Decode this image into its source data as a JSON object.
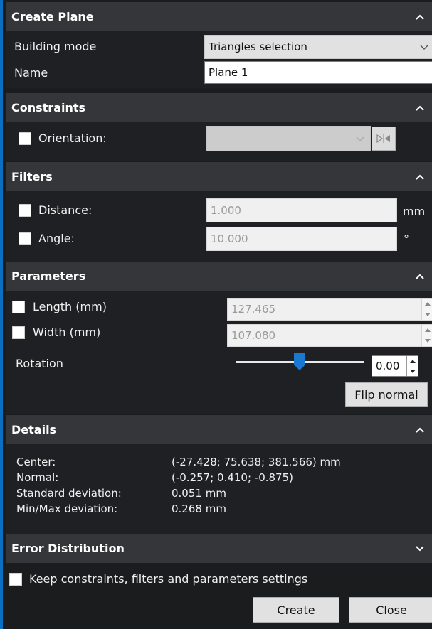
{
  "create_plane": {
    "header": "Create Plane",
    "building_mode_label": "Building mode",
    "building_mode_value": "Triangles selection",
    "name_label": "Name",
    "name_value": "Plane 1"
  },
  "constraints": {
    "header": "Constraints",
    "orientation_label": "Orientation:",
    "orientation_checked": false
  },
  "filters": {
    "header": "Filters",
    "distance_label": "Distance:",
    "distance_value": "1.000",
    "distance_unit": "mm",
    "angle_label": "Angle:",
    "angle_value": "10.000",
    "angle_unit": "°"
  },
  "parameters": {
    "header": "Parameters",
    "length_label": "Length (mm)",
    "length_value": "127.465",
    "width_label": "Width (mm)",
    "width_value": "107.080",
    "rotation_label": "Rotation",
    "rotation_value": "0.00",
    "rotation_slider_fraction": 0.5,
    "flip_normal_label": "Flip normal"
  },
  "details": {
    "header": "Details",
    "rows": [
      {
        "key": "Center:",
        "value": "(-27.428; 75.638; 381.566) mm"
      },
      {
        "key": "Normal:",
        "value": "(-0.257; 0.410; -0.875)"
      },
      {
        "key": "Standard deviation:",
        "value": "0.051 mm"
      },
      {
        "key": "Min/Max deviation:",
        "value": "0.268 mm"
      }
    ]
  },
  "error_distribution": {
    "header": "Error Distribution"
  },
  "footer": {
    "keep_settings_label": "Keep constraints, filters and parameters settings",
    "create_label": "Create",
    "close_label": "Close"
  },
  "icons": {
    "collapse": "chevron-up-icon",
    "expand": "chevron-down-icon",
    "flip_orientation": "flip-orientation-icon"
  },
  "colors": {
    "accent": "#0a6fc0",
    "header_bg": "#35363a",
    "panel_bg": "#1f2023",
    "slider_handle": "#1a78d2"
  }
}
